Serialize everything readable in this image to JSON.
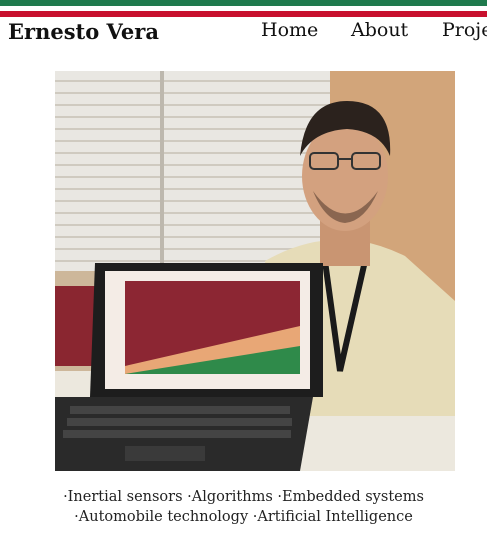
{
  "site": {
    "title": "Ernesto Vera"
  },
  "nav": {
    "home": "Home",
    "about": "About",
    "projects": "Projects"
  },
  "photo": {
    "description_icon": "portrait-photo"
  },
  "tags": {
    "line1": "·Inertial sensors ·Algorithms ·Embedded systems",
    "line2": "·Automobile technology ·Artificial Intelligence"
  },
  "colors": {
    "green": "#1f7a4d",
    "red": "#c8102e",
    "white": "#ffffff"
  }
}
